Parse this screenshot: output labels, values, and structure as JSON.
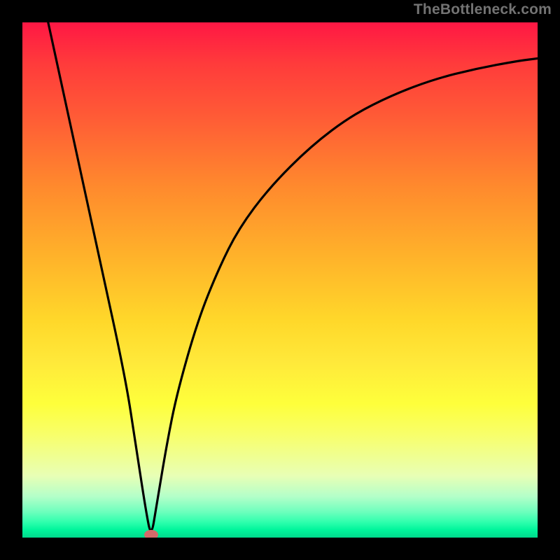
{
  "attribution": "TheBottleneck.com",
  "chart_data": {
    "type": "line",
    "title": "",
    "xlabel": "",
    "ylabel": "",
    "xlim": [
      0,
      100
    ],
    "ylim": [
      0,
      100
    ],
    "series": [
      {
        "name": "bottleneck-curve",
        "x": [
          5,
          10,
          15,
          20,
          22,
          24,
          25,
          26,
          28,
          30,
          34,
          38,
          42,
          48,
          56,
          64,
          72,
          80,
          88,
          96,
          100
        ],
        "y": [
          100,
          77,
          54,
          31,
          18,
          5,
          0,
          6,
          18,
          28,
          42,
          52,
          60,
          68,
          76,
          82,
          86,
          89,
          91,
          92.5,
          93
        ]
      }
    ],
    "marker": {
      "x": 25,
      "y": 0
    },
    "gradient_stops": [
      {
        "pos": 0,
        "color": "#ff1744"
      },
      {
        "pos": 50,
        "color": "#ffc928"
      },
      {
        "pos": 80,
        "color": "#feff3b"
      },
      {
        "pos": 100,
        "color": "#00d98c"
      }
    ]
  }
}
